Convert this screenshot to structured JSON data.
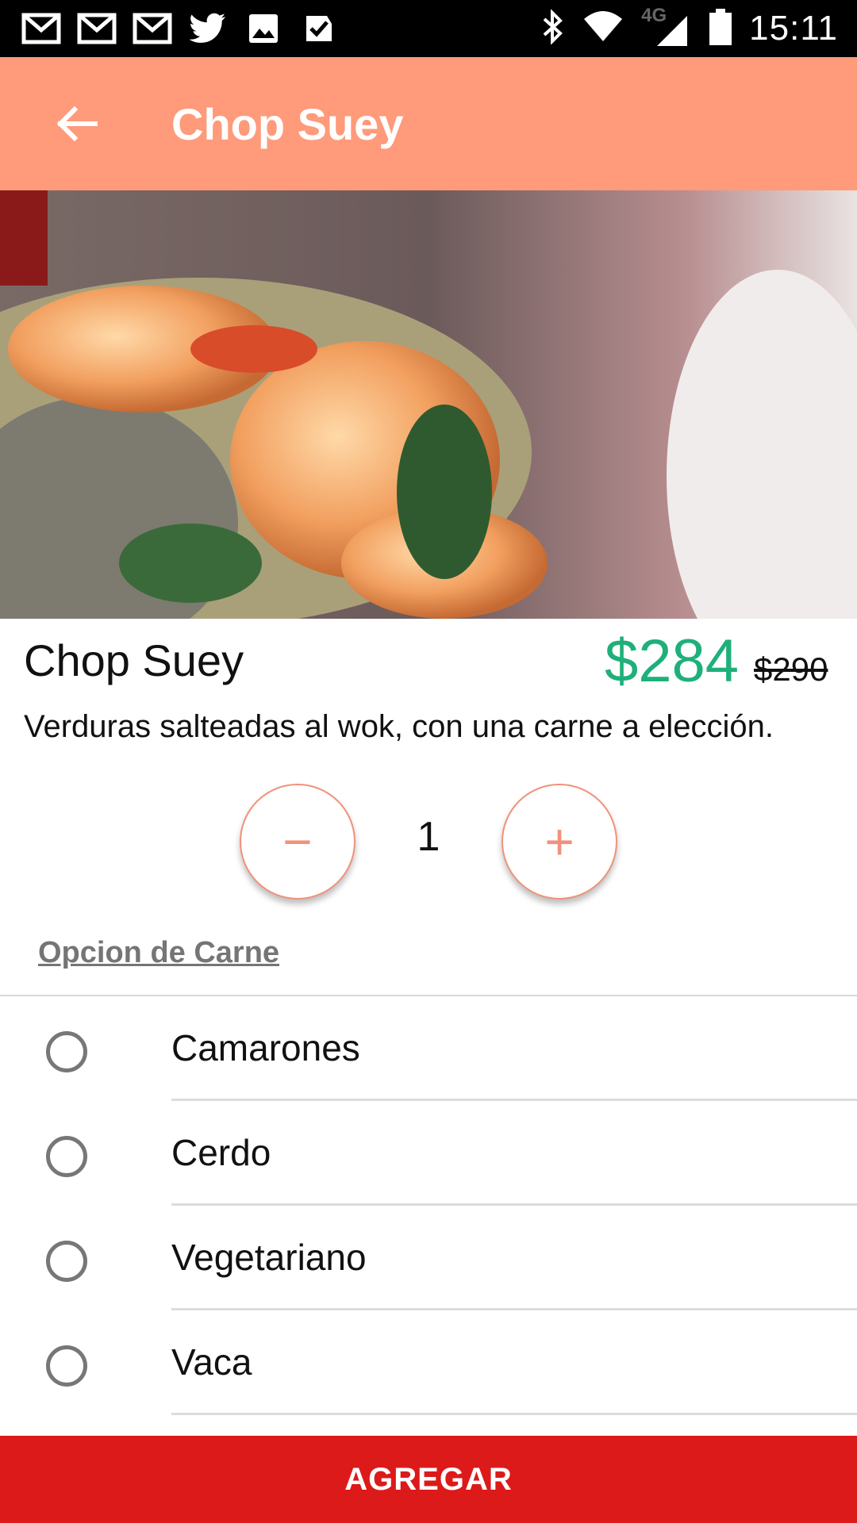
{
  "status_bar": {
    "time": "15:11",
    "network_label": "4G",
    "icons": [
      "gmail-icon",
      "gmail-icon",
      "gmail-icon",
      "twitter-icon",
      "image-icon",
      "check-task-icon"
    ],
    "right_icons": [
      "bluetooth-icon",
      "wifi-icon",
      "signal-icon",
      "battery-icon"
    ]
  },
  "app_bar": {
    "title": "Chop Suey",
    "background": "#ff9a7b"
  },
  "product": {
    "name": "Chop Suey",
    "price_current": "$284",
    "price_old": "$290",
    "description": "Verduras salteadas al wok, con una carne a elección.",
    "price_color": "#1fb07a"
  },
  "quantity": {
    "minus_label": "−",
    "value": "1",
    "plus_label": "+"
  },
  "options_section": {
    "title": "Opcion de Carne",
    "options": [
      {
        "label": "Camarones",
        "selected": false
      },
      {
        "label": "Cerdo",
        "selected": false
      },
      {
        "label": "Vegetariano",
        "selected": false
      },
      {
        "label": "Vaca",
        "selected": false
      }
    ]
  },
  "footer": {
    "add_label": "AGREGAR",
    "background": "#dc1a1a"
  }
}
